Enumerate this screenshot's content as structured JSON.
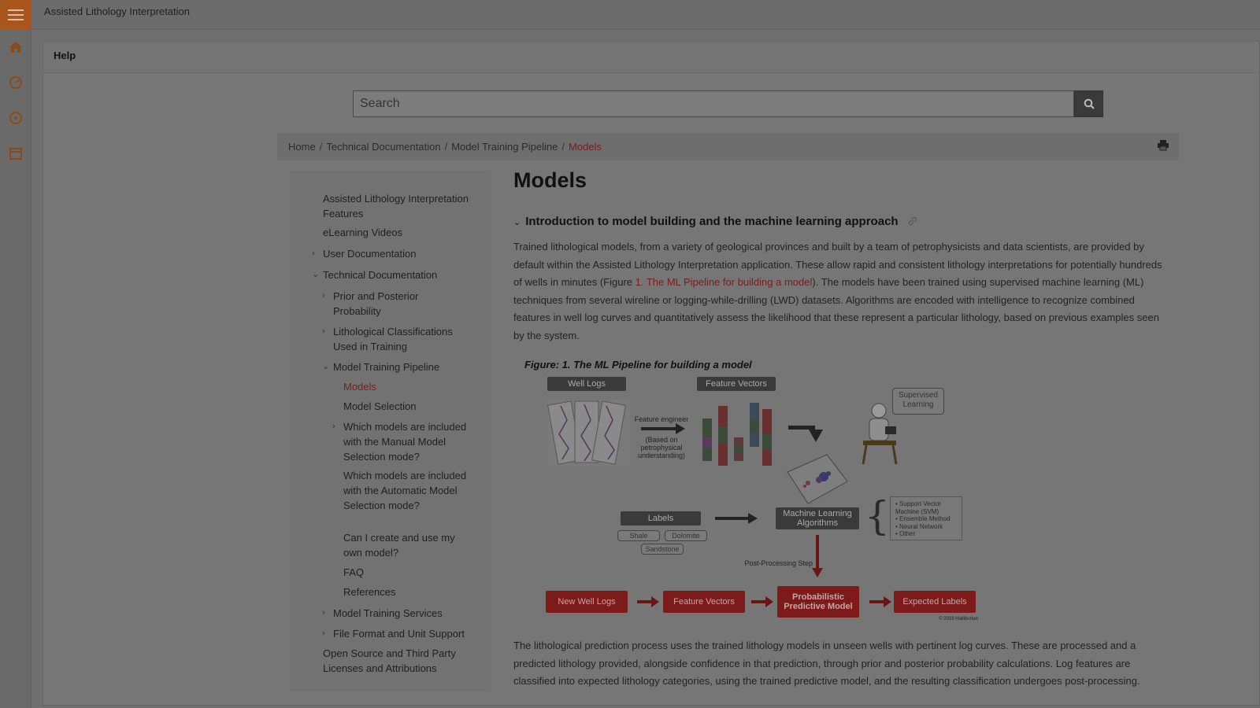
{
  "app": {
    "title": "Assisted Lithology Interpretation"
  },
  "icons": {
    "menu": "hamburger-icon",
    "home": "home-icon",
    "dashboard": "speedometer-icon",
    "help": "help-circle-icon",
    "calendar": "calendar-icon",
    "search": "search-icon",
    "print": "print-icon",
    "link": "link-icon"
  },
  "colors": {
    "accent": "#a8561c",
    "link": "#7a1c1c",
    "figure_red": "#7d1b1b"
  },
  "panel": {
    "title": "Help"
  },
  "search": {
    "placeholder": "Search"
  },
  "breadcrumb": [
    {
      "label": "Home"
    },
    {
      "label": "Technical Documentation"
    },
    {
      "label": "Model Training Pipeline"
    },
    {
      "label": "Models"
    }
  ],
  "toc": [
    {
      "label": "Assisted Lithology Interpretation Features"
    },
    {
      "label": "eLearning Videos"
    },
    {
      "label": "User Documentation"
    },
    {
      "label": "Technical Documentation"
    },
    {
      "label": "Prior and Posterior Probability"
    },
    {
      "label": "Lithological Classifications Used in Training"
    },
    {
      "label": "Model Training Pipeline"
    },
    {
      "label": "Models"
    },
    {
      "label": "Model Selection"
    },
    {
      "label": "Which models are included with the Manual Model Selection mode?"
    },
    {
      "label": "Which models are included with the Automatic Model Selection mode?"
    },
    {
      "label": "Can I create and use my own model?"
    },
    {
      "label": "FAQ"
    },
    {
      "label": "References"
    },
    {
      "label": "Model Training Services"
    },
    {
      "label": "File Format and Unit Support"
    },
    {
      "label": "Open Source and Third Party Licenses and Attributions"
    }
  ],
  "content": {
    "title": "Models",
    "section_heading": "Introduction to model building and the machine learning approach",
    "para1_a": "Trained lithological models, from a variety of geological provinces and built by a team of petrophysicists and data scientists, are provided by default within the Assisted Lithology Interpretation application. These allow rapid and consistent lithology interpretations for potentially hundreds of wells in minutes (Figure ",
    "para1_link": "1. The ML Pipeline for building a model",
    "para1_b": "). The models have been trained using supervised machine learning (ML) techniques from several wireline or logging-while-drilling (LWD) datasets. Algorithms are encoded with intelligence to recognize combined features in well log curves and quantitatively assess the likelihood that these represent a particular lithology, based on previous examples seen by the system.",
    "figure_caption": "Figure: 1. The ML Pipeline for building a model",
    "para2": "The lithological prediction process uses the trained lithology models in unseen wells with pertinent log curves. These are processed and a predicted lithology provided, alongside confidence in that prediction, through prior and posterior probability calculations. Log features are classified into expected lithology categories, using the trained predictive model, and the resulting classification undergoes post-processing."
  },
  "figure": {
    "well_logs": "Well Logs",
    "feature_vectors_top": "Feature Vectors",
    "feature_engineer": "Feature engineer",
    "feature_engineer_note": "(Based on petrophysical understanding)",
    "supervised_learning": "Supervised Learning",
    "labels": "Labels",
    "shale": "Shale",
    "dolomite": "Dolomite",
    "sandstone": "Sandstone",
    "ml_algorithms": "Machine Learning Algorithms",
    "algo_list": [
      "Support Vector Machine (SVM)",
      "Ensemble Method",
      "Neural Network",
      "Other"
    ],
    "post_processing": "Post-Processing Step",
    "new_well_logs": "New Well Logs",
    "feature_vectors_bottom": "Feature Vectors",
    "predictive_model": "Probabilistic Predictive Model",
    "expected_labels": "Expected Labels",
    "copyright": "© 2019 Halliburton"
  }
}
